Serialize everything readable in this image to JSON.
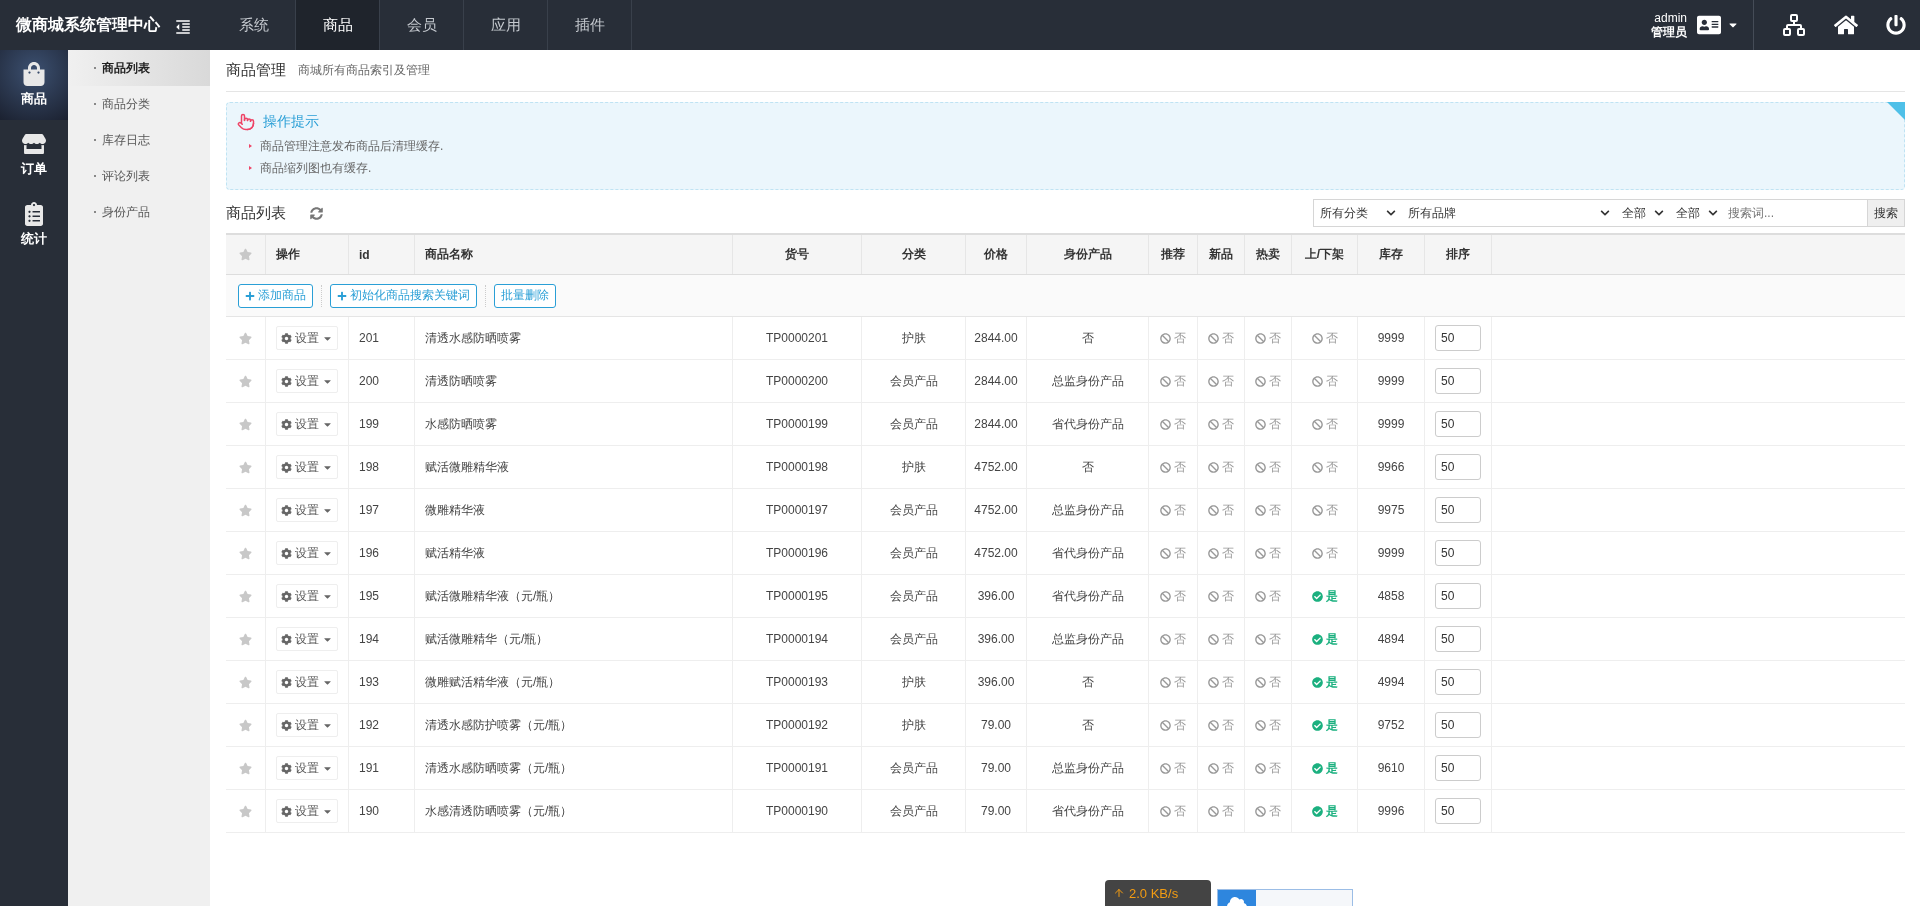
{
  "brand": "微商城系统管理中心",
  "top_nav": [
    {
      "label": "系统",
      "selected": false
    },
    {
      "label": "商品",
      "selected": true
    },
    {
      "label": "会员",
      "selected": false
    },
    {
      "label": "应用",
      "selected": false
    },
    {
      "label": "插件",
      "selected": false
    }
  ],
  "user": {
    "name": "admin",
    "role": "管理员"
  },
  "side_nav": [
    {
      "label": "商品",
      "kind": "bag",
      "selected": true
    },
    {
      "label": "订单",
      "kind": "store",
      "selected": false
    },
    {
      "label": "统计",
      "kind": "clipboard",
      "selected": false
    }
  ],
  "sub_nav": [
    {
      "label": "商品列表",
      "selected": true
    },
    {
      "label": "商品分类",
      "selected": false
    },
    {
      "label": "库存日志",
      "selected": false
    },
    {
      "label": "评论列表",
      "selected": false
    },
    {
      "label": "身份产品",
      "selected": false
    }
  ],
  "page": {
    "title": "商品管理",
    "subtitle": "商城所有商品索引及管理"
  },
  "tips": {
    "title": "操作提示",
    "items": [
      "商品管理注意发布商品后清理缓存.",
      "商品缩列图也有缓存."
    ]
  },
  "list_title": "商品列表",
  "filters": {
    "category": "所有分类",
    "brand": "所有品牌",
    "status_a": "全部",
    "status_b": "全部",
    "placeholder": "搜索词...",
    "search_button": "搜索"
  },
  "columns": [
    "操作",
    "id",
    "商品名称",
    "货号",
    "分类",
    "价格",
    "身份产品",
    "推荐",
    "新品",
    "热卖",
    "上/下架",
    "库存",
    "排序"
  ],
  "actions": [
    "添加商品",
    "初始化商品搜索关键词",
    "批量删除"
  ],
  "rows": [
    {
      "id": "201",
      "name": "清透水感防晒喷雾",
      "menu": "设置",
      "sn": "TP0000201",
      "category": "护肤",
      "price": "2844.00",
      "identity": "否",
      "flags": [
        {
          "on": false,
          "text": "否"
        },
        {
          "on": false,
          "text": "否"
        },
        {
          "on": false,
          "text": "否"
        },
        {
          "on": false,
          "text": "否"
        }
      ],
      "stock": "9999",
      "sort": "50"
    },
    {
      "id": "200",
      "name": "清透防晒喷雾",
      "menu": "设置",
      "sn": "TP0000200",
      "category": "会员产品",
      "price": "2844.00",
      "identity": "总监身份产品",
      "flags": [
        {
          "on": false,
          "text": "否"
        },
        {
          "on": false,
          "text": "否"
        },
        {
          "on": false,
          "text": "否"
        },
        {
          "on": false,
          "text": "否"
        }
      ],
      "stock": "9999",
      "sort": "50"
    },
    {
      "id": "199",
      "name": "水感防晒喷雾",
      "menu": "设置",
      "sn": "TP0000199",
      "category": "会员产品",
      "price": "2844.00",
      "identity": "省代身份产品",
      "flags": [
        {
          "on": false,
          "text": "否"
        },
        {
          "on": false,
          "text": "否"
        },
        {
          "on": false,
          "text": "否"
        },
        {
          "on": false,
          "text": "否"
        }
      ],
      "stock": "9999",
      "sort": "50"
    },
    {
      "id": "198",
      "name": "赋活微雕精华液",
      "menu": "设置",
      "sn": "TP0000198",
      "category": "护肤",
      "price": "4752.00",
      "identity": "否",
      "flags": [
        {
          "on": false,
          "text": "否"
        },
        {
          "on": false,
          "text": "否"
        },
        {
          "on": false,
          "text": "否"
        },
        {
          "on": false,
          "text": "否"
        }
      ],
      "stock": "9966",
      "sort": "50"
    },
    {
      "id": "197",
      "name": "微雕精华液",
      "menu": "设置",
      "sn": "TP0000197",
      "category": "会员产品",
      "price": "4752.00",
      "identity": "总监身份产品",
      "flags": [
        {
          "on": false,
          "text": "否"
        },
        {
          "on": false,
          "text": "否"
        },
        {
          "on": false,
          "text": "否"
        },
        {
          "on": false,
          "text": "否"
        }
      ],
      "stock": "9975",
      "sort": "50"
    },
    {
      "id": "196",
      "name": "赋活精华液",
      "menu": "设置",
      "sn": "TP0000196",
      "category": "会员产品",
      "price": "4752.00",
      "identity": "省代身份产品",
      "flags": [
        {
          "on": false,
          "text": "否"
        },
        {
          "on": false,
          "text": "否"
        },
        {
          "on": false,
          "text": "否"
        },
        {
          "on": false,
          "text": "否"
        }
      ],
      "stock": "9999",
      "sort": "50"
    },
    {
      "id": "195",
      "name": "赋活微雕精华液（元/瓶）",
      "menu": "设置",
      "sn": "TP0000195",
      "category": "会员产品",
      "price": "396.00",
      "identity": "省代身份产品",
      "flags": [
        {
          "on": false,
          "text": "否"
        },
        {
          "on": false,
          "text": "否"
        },
        {
          "on": false,
          "text": "否"
        },
        {
          "on": true,
          "text": "是"
        }
      ],
      "stock": "4858",
      "sort": "50"
    },
    {
      "id": "194",
      "name": "赋活微雕精华（元/瓶）",
      "menu": "设置",
      "sn": "TP0000194",
      "category": "会员产品",
      "price": "396.00",
      "identity": "总监身份产品",
      "flags": [
        {
          "on": false,
          "text": "否"
        },
        {
          "on": false,
          "text": "否"
        },
        {
          "on": false,
          "text": "否"
        },
        {
          "on": true,
          "text": "是"
        }
      ],
      "stock": "4894",
      "sort": "50"
    },
    {
      "id": "193",
      "name": "微雕赋活精华液（元/瓶）",
      "menu": "设置",
      "sn": "TP0000193",
      "category": "护肤",
      "price": "396.00",
      "identity": "否",
      "flags": [
        {
          "on": false,
          "text": "否"
        },
        {
          "on": false,
          "text": "否"
        },
        {
          "on": false,
          "text": "否"
        },
        {
          "on": true,
          "text": "是"
        }
      ],
      "stock": "4994",
      "sort": "50"
    },
    {
      "id": "192",
      "name": "清透水感防护喷雾（元/瓶）",
      "menu": "设置",
      "sn": "TP0000192",
      "category": "护肤",
      "price": "79.00",
      "identity": "否",
      "flags": [
        {
          "on": false,
          "text": "否"
        },
        {
          "on": false,
          "text": "否"
        },
        {
          "on": false,
          "text": "否"
        },
        {
          "on": true,
          "text": "是"
        }
      ],
      "stock": "9752",
      "sort": "50"
    },
    {
      "id": "191",
      "name": "清透水感防晒喷雾（元/瓶）",
      "menu": "设置",
      "sn": "TP0000191",
      "category": "会员产品",
      "price": "79.00",
      "identity": "总监身份产品",
      "flags": [
        {
          "on": false,
          "text": "否"
        },
        {
          "on": false,
          "text": "否"
        },
        {
          "on": false,
          "text": "否"
        },
        {
          "on": true,
          "text": "是"
        }
      ],
      "stock": "9610",
      "sort": "50"
    },
    {
      "id": "190",
      "name": "水感清透防晒喷雾（元/瓶）",
      "menu": "设置",
      "sn": "TP0000190",
      "category": "会员产品",
      "price": "79.00",
      "identity": "省代身份产品",
      "flags": [
        {
          "on": false,
          "text": "否"
        },
        {
          "on": false,
          "text": "否"
        },
        {
          "on": false,
          "text": "否"
        },
        {
          "on": true,
          "text": "是"
        }
      ],
      "stock": "9996",
      "sort": "50"
    }
  ],
  "speed_widget": {
    "text": "2.0 KB/s"
  }
}
